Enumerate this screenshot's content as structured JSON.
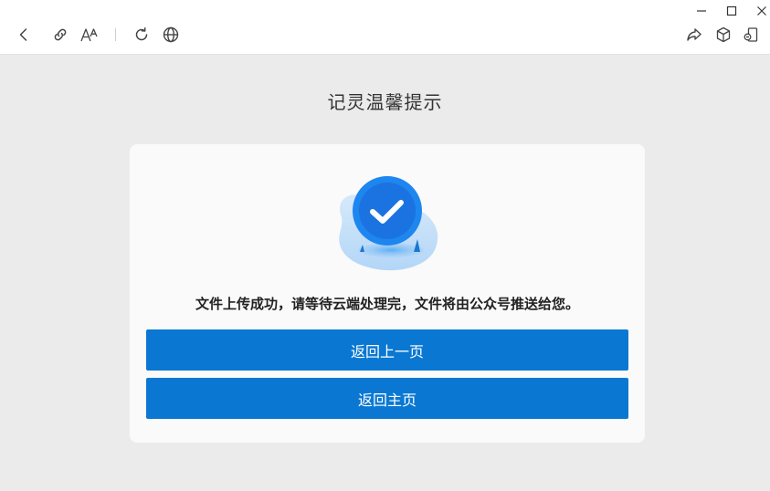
{
  "window_controls": {
    "minimize_icon": "minimize-icon",
    "maximize_icon": "maximize-icon",
    "close_icon": "close-icon"
  },
  "toolbar": {
    "left": [
      "back-icon",
      "link-icon",
      "font-size-icon",
      "refresh-icon",
      "globe-icon"
    ],
    "right": [
      "share-icon",
      "cube-icon",
      "mini-program-icon"
    ]
  },
  "page": {
    "heading": "记灵温馨提示",
    "message": "文件上传成功，请等待云端处理完，文件将由公众号推送给您。",
    "back_button": "返回上一页",
    "home_button": "返回主页"
  },
  "colors": {
    "accent": "#0a78d2",
    "background": "#ebebeb",
    "card": "#fafafa"
  }
}
